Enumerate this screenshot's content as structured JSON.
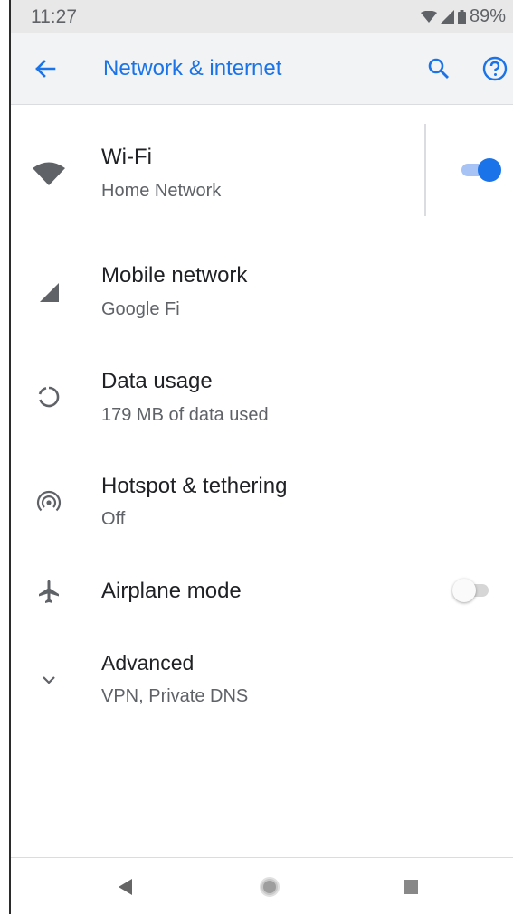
{
  "status_bar": {
    "time": "11:27",
    "battery_percent": "89%",
    "icons": [
      "wifi-icon",
      "cell-signal-icon",
      "battery-icon"
    ]
  },
  "app_bar": {
    "title": "Network & internet",
    "back_icon": "arrow-back-icon",
    "actions": [
      "search-icon",
      "help-icon"
    ],
    "accent_color": "#1a73e8"
  },
  "settings": [
    {
      "id": "wifi",
      "title": "Wi-Fi",
      "summary": "Home Network",
      "icon": "wifi-icon",
      "toggle": true
    },
    {
      "id": "mobile",
      "title": "Mobile network",
      "summary": "Google Fi",
      "icon": "cell-signal-icon"
    },
    {
      "id": "data",
      "title": "Data usage",
      "summary": "179 MB of data used",
      "icon": "data-usage-icon"
    },
    {
      "id": "hotspot",
      "title": "Hotspot & tethering",
      "summary": "Off",
      "icon": "hotspot-icon"
    },
    {
      "id": "airplane",
      "title": "Airplane mode",
      "icon": "airplane-icon",
      "toggle": false
    },
    {
      "id": "advanced",
      "title": "Advanced",
      "summary": "VPN, Private DNS",
      "icon": "chevron-down-icon"
    }
  ],
  "nav_bar": {
    "buttons": [
      "back-triangle-icon",
      "home-circle-icon",
      "recents-square-icon"
    ]
  }
}
